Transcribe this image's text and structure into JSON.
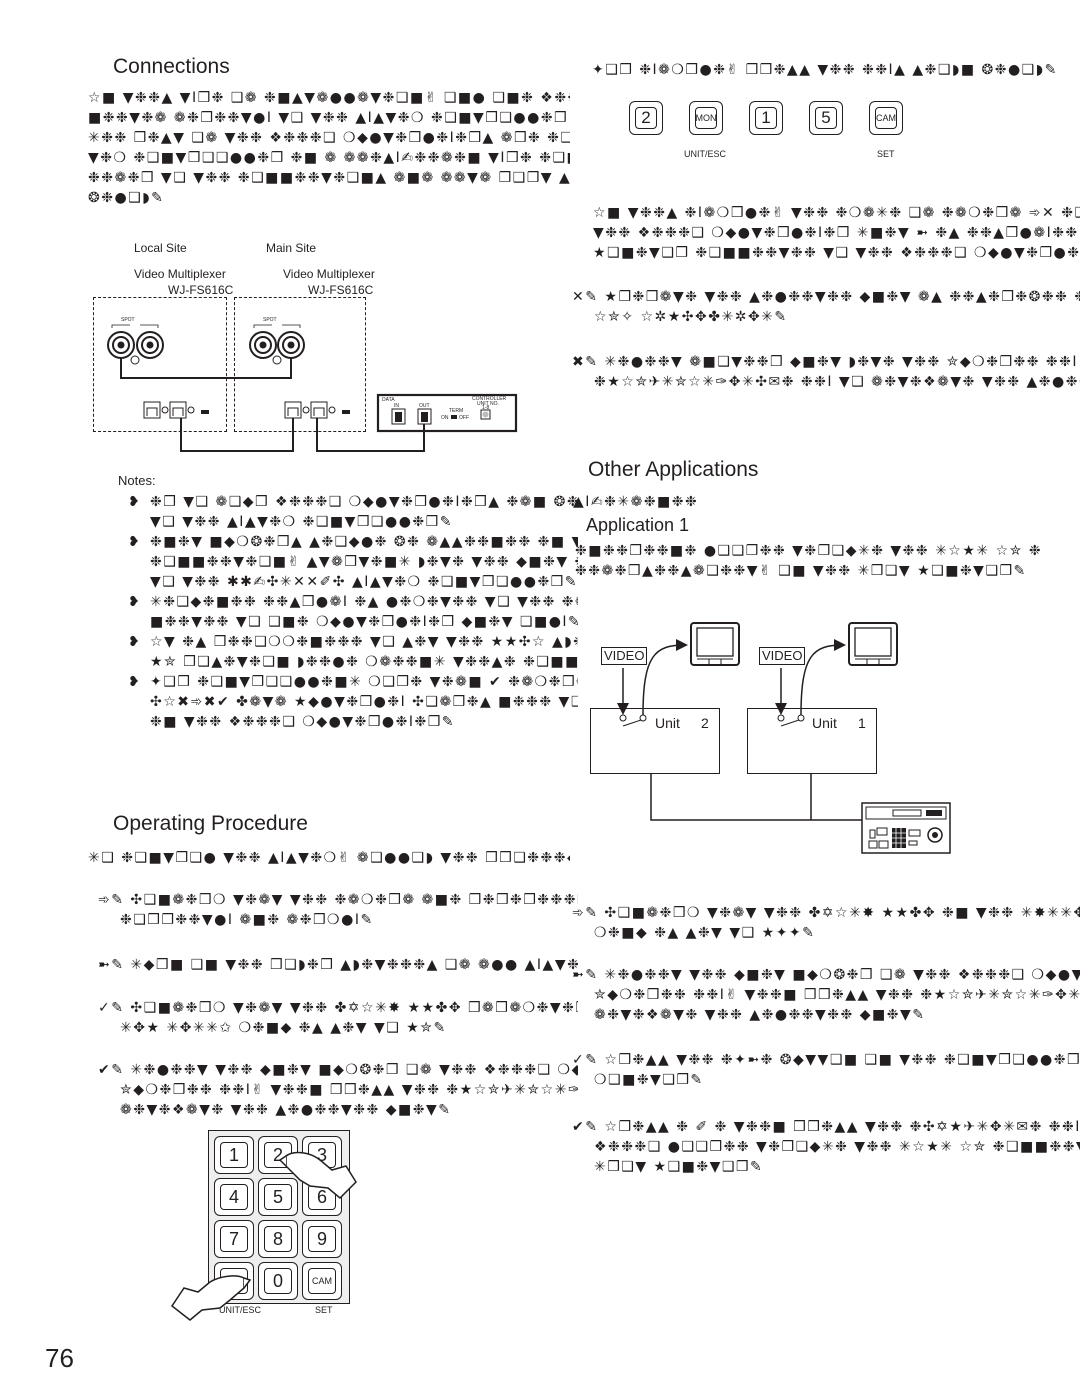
{
  "page_number": "76",
  "connections": {
    "title": "Connections",
    "body": [
      "☆■ ▼❉❉▲ ▼I❒❉ ❑❁ ❉■▲▼❁●●❁▼❉❑■✌ ❑■● ❑■❉ ❖❉❉❉❑ ⌒",
      "■❉❉▼❉❁ ❁❉❒❉❉▼●I ▼❑ ▼❉❉ ▲I▲▼❉❍ ❉❑■▼❒❑●●❉❒ ❍I ❁",
      "✳❉❉ ❒❉▲▼ ❑❁ ▼❉❉ ❖❉❉❉❑ ❍◆●▼❉❒●❉I❉❒▲ ❁❒❉ ❉❑■■❉",
      "▼❉❍ ❉❑■▼❒❑❑●●❉❒ ❉■ ❁ ❁❁❉▲I✍❉❉❁❉■ ▼I❒❉ ❉❑■■❉❉▼",
      "❉❉❁❉❒ ▼❑ ▼❉❉ ❉❑■■❉❉▼❉❑■▲ ❁■❁ ❁❁▼❁ ❒❑❒▼ ▲❉▼",
      "❂❉●❑◗✎"
    ],
    "diagram": {
      "local_site": "Local Site",
      "main_site": "Main Site",
      "device_label": "Video Multiplexer",
      "device_model": "WJ-FS616C",
      "spot": "SPOT",
      "out": "OUT",
      "in": "IN",
      "data": "DATA",
      "term": "TERM",
      "on": "ON",
      "off": "OFF",
      "controller_label": "CONTROLLER",
      "unit_no": "UNIT NO.",
      "unit_range": "1-8"
    }
  },
  "setup_right": {
    "intro": "✦❑❒ ❉I❁❍❒●❉✌ ❒❒❉▲▲ ▼❉❉ ❉❉I▲ ▲❉❑◗■ ❂❉●❑◗✎",
    "keys": [
      "2",
      "MON",
      "1",
      "5",
      "CAM"
    ],
    "key_sub_unit": "UNIT/ESC",
    "key_sub_set": "SET",
    "para": [
      "☆■ ▼❉❉▲ ❉I❁❍❒●❉✌ ▼❉❉ ❉❍❁✳❉ ❑❁ ❉❁❍❉❒❁ ➾✕ ❉❑■■❉",
      "▼❉❉ ❖❉❉❉❑ ❍◆●▼❉❒●❉I❉❒ ✳■❉▼ ➼ ❉▲ ❉❉▲❒●❁I❉❉ ❑■",
      "★❑■❉▼❑❒ ❉❑■■❉❉▼❉❉ ▼❑ ▼❉❉ ❖❉❉❉❑ ❍◆●▼❉❒●❉I❉❒ ✳■"
    ],
    "step2": [
      "✕✎ ★❒❉❒❁▼❉ ▼❉❉ ▲❉●❉❉▼❉❉ ◆■❉▼ ❁▲ ❉❉▲❉❒❉❂❉❉ ❉■ ▼",
      "☆✮✧ ☆✲★✣✥✤✳✲✥✳✎"
    ],
    "step3": [
      "✖✎ ✳❉●❉❉▼ ❁■❑▼❉❉❒ ◆■❉▼ ◗❉▼❉ ▼❉❉ ✮◆❍❉❒❉❉ ❉❉I✌ ▼❉",
      "❉★☆✮✈✳✮☆✳✑✥✳✣✉❉ ❉❉I ▼❑ ❁❉▼❉❖❁▼❉ ▼❉❉ ▲❉●❉❉▼❉"
    ]
  },
  "notes": {
    "title": "Notes:",
    "items": [
      [
        "❉❒ ▼❑ ❁❑◆❒ ❖❉❉❉❑ ❍◆●▼❉❒●❉I❉❒▲ ❉❁■ ❂❉ ❉❁❉▲I✍❉❉❁❉■❉",
        "▼❑ ▼❉❉ ▲I▲▼❉❍ ❉❑■▼❒❑●●❉❒✎"
      ],
      [
        "❉■❉▼ ■◆❍❂❉❒▲ ▲❉❑◆●❉ ❂❉ ❁▲▲❉❉■❉❉ ❉■ ▼❉❉ ❉❉▲❉❉▲",
        "❉❑■■❉❉▼❉❑■✌ ▲▼❁❒▼❉■✳ ◗❉▼❉ ▼❉❉ ◆■❉▼ ❉❑■■❉❉▼❉❉",
        "▼❑ ▼❉❉ ✱✱✍✣✳✕✕✐✣ ▲I▲▼❉❍ ❉❑■▼❒❑●●❉❒✎"
      ],
      [
        "✳❉❑◆❉■❉❉ ❉❉▲❒●❁I ❉▲ ●❉❍❉▼❉❉ ▼❑ ▼❉❉ ❉❁⌒",
        "■❉❉▼❉❉ ▼❑ ❑■❉ ❍◆●▼❉❒●❉I❉❒ ◆■❉▼ ❑■●I✎"
      ],
      [
        "☆▼ ❉▲ ❒❉❉❑❍❍❉■❉❉❉ ▼❑ ▲❉▼ ▼❉❉ ★★✣☆ ▲◗❉",
        "★✮ ❒❑▲❉▼❉❑■ ◗❉❉●❉ ❍❁❉❉■✳ ▼❉❉▲❉ ❉❑■■❉❉▼"
      ],
      [
        "✦❑❒ ❉❑■▼❒❑❑●●❉■✳ ❍❑❒❉ ▼❉❁■ ✔ ❉❁❍❉❒❁▲✌ ❁",
        "✣☆✖➾✖✔ ✤❁▼❁ ★◆●▼❉❒●❉I ✣❑❁❒❉▲ ■❉❉❉ ▼❑ ❁",
        "❉■ ▼❉❉ ❖❉❉❉❑ ❍◆●▼❉❒●❉I❉❒✎"
      ]
    ]
  },
  "other_applications": {
    "title": "Other Applications",
    "subtitle_tail": "▲I✍❉✳❁❉■❉❉",
    "application_1": {
      "title": "Application 1",
      "body": [
        "❉■❉❉❒❉❉■❉ ●❑❑❒❉❉ ▼❉❒❑◆✳❉ ▼❉❉ ✳☆★✳ ☆✮ ❉",
        "❉❉❁❉❒▲❉❉▲❁❑❉❉▼✌ ❑■ ▼❉❉ ✳❒❑▼ ★❑■❉▼❑❒✎"
      ],
      "diagram": {
        "video_label": "VIDEO",
        "unit_word": "Unit",
        "unit_left_no": "2",
        "unit_right_no": "1"
      }
    }
  },
  "operating_procedure": {
    "title": "Operating Procedure",
    "intro": "✳❑ ❉❑■▼❒❑● ▼❉❉ ▲I▲▼❉❍✌ ❁❑●●❑◗ ▼❉❉ ❒❒❑❉❉❉◆❒❉ ▲",
    "steps": [
      {
        "n": "➾✎",
        "lines": [
          "✣❑■❁❉❒❍ ▼❉❁▼ ▼❉❉ ❉❁❍❉❒❁ ❁■❉ ❒❉❒❉❒❉❉❉❒❁●▲ ❁❒❉ ❉❑■■❉❉▼❉❉",
          "❉❑❒❒❉❉▼●I ❁■❉ ❁❉❒❍●I✎"
        ]
      },
      {
        "n": "➼✎",
        "lines": [
          "✳◆❒■ ❑■ ▼❉❉ ❒❑◗❉❒ ▲◗❉▼❉❉❉▲ ❑❁ ❁●● ▲I▲▼❉❍ ❉❑■❒❑■❉■▼▲✎"
        ]
      },
      {
        "n": "✓✎",
        "lines": [
          "✣❑■❁❉❒❍ ▼❉❁▼ ▼❉❉ ✤✡☆✳✸ ★★✤✥ ❒❁❒❁❍❉▼❉❒ ❉■ ▼❉❉ ✳✸✳✳✥✮",
          "✳✥★ ✳✥✳✳✩ ❍❉■◆ ❉▲ ▲❉▼ ▼❑ ★✮✎"
        ]
      },
      {
        "n": "✔✎",
        "lines": [
          "✳❉●❉❉▼ ▼❉❉ ◆■❉▼ ■◆❍❂❉❒ ❑❁ ▼❉❉ ❖❉❉❉❑ ❍◆●▼❉❒●❉I❉❒",
          "✮◆❍❉❒❉❉ ❉❉I✌ ▼❉❉■ ❒❒❉▲▲ ▼❉❉ ❉★☆✮✈✳✮☆✳✑✥✳✣",
          "❁❉▼❉❖❁▼❉ ▼❉❉ ▲❉●❉❉▼❉❉ ◆■❉▼✎"
        ]
      }
    ],
    "keypad": {
      "keys": [
        "1",
        "2",
        "3",
        "4",
        "5",
        "6",
        "7",
        "8",
        "9",
        "MON",
        "0",
        "CAM"
      ],
      "sub_unit": "UNIT/ESC",
      "sub_set": "SET"
    }
  },
  "right_steps": [
    {
      "n": "➾✎",
      "lines": [
        "✣❑■❁❉❒❍ ▼❉❁▼ ▼❉❉ ✤✡☆✳✸ ★★✤✥ ❉■ ▼❉❉ ✳✸✳✳✥★",
        "❍❉■◆ ❉▲ ▲❉▼ ▼❑ ★✦✦✎"
      ]
    },
    {
      "n": "➼✎",
      "lines": [
        "✳❉●❉❉▼ ▼❉❉ ◆■❉▼ ■◆❍❂❉❒ ❑❁ ▼❉❉ ❖❉❉❉❑ ❍◆●▼❉❒❉",
        "✮◆❍❉❒❉❉ ❉❉I✌ ▼❉❉■ ❒❒❉▲▲ ▼❉❉ ❉★☆✮✈✳✮☆✳✑✥✳✣✉",
        "❁❉▼❉❖❁▼❉ ▼❉❉ ▲❉●❉❉▼❉❉ ◆■❉▼✎"
      ]
    },
    {
      "n": "✓✎",
      "lines": [
        "☆❒❉▲▲ ▼❉❉ ❉✦➼❉ ❂◆▼▼❑■ ❑■ ▼❉❉ ❉❑■▼❒❑●●❉❒ ▼❑",
        "❍❑■❉▼❑❒✎"
      ]
    },
    {
      "n": "✔✎",
      "lines": [
        "☆❒❉▲▲ ❉ ✐ ❉ ▼❉❉■ ❒❒❉▲▲ ▼❉❉ ❉✣✡★✈✳✥✳✉❉ ❉❉I ▼❑",
        "❖❉❉❉❑ ●❑❑❒❉❉ ▼❉❒❑◆✳❉ ▼❉❉ ✳☆★✳ ☆✮ ❉❑■■❉❉▼❑❒",
        "✳❒❑▼ ★❑■❉▼❑❒✎"
      ]
    }
  ]
}
